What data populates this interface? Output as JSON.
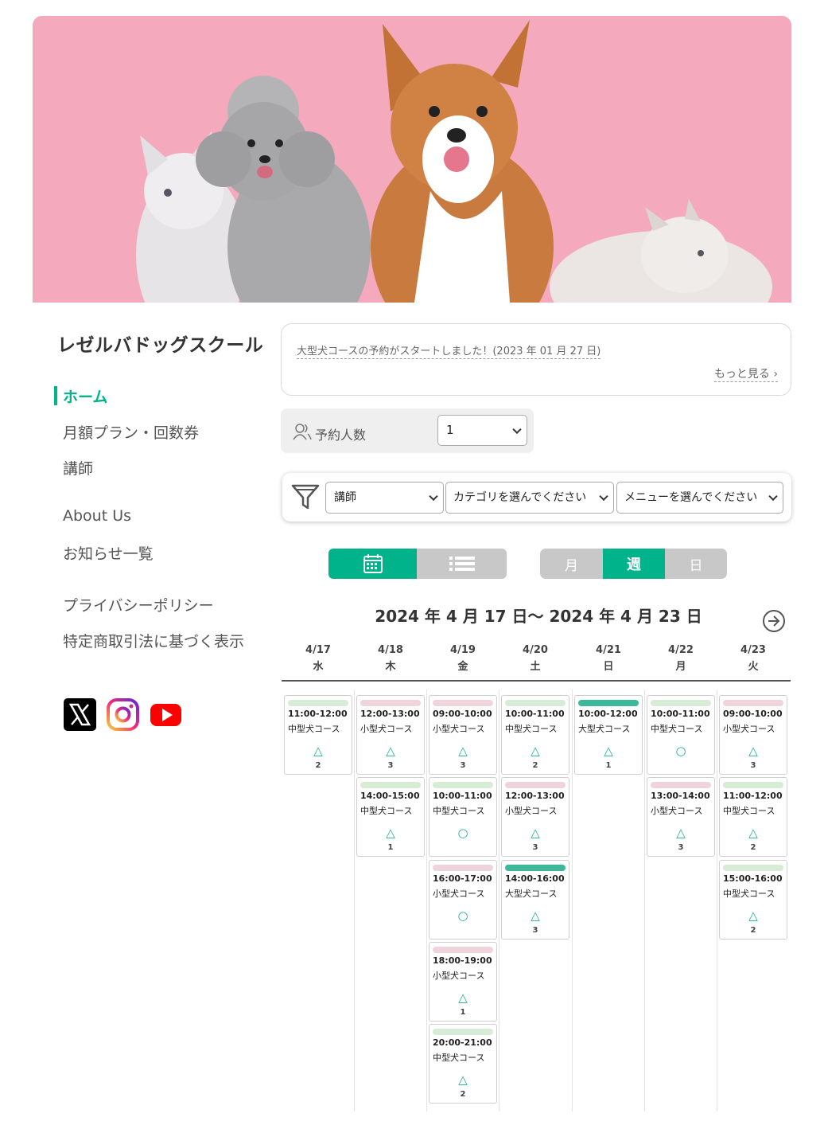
{
  "site": {
    "title": "レゼルバドッグスクール"
  },
  "nav": {
    "home": "ホーム",
    "plans": "月額プラン・回数券",
    "instructors": "講師",
    "about": "About Us",
    "news": "お知らせ一覧",
    "privacy": "プライバシーポリシー",
    "tokusho": "特定商取引法に基づく表示"
  },
  "notice": {
    "text": "大型犬コースの予約がスタートしました！(2023 年 01 月 27 日)",
    "more": "もっと見る"
  },
  "guests": {
    "label": "予約人数",
    "value": "1"
  },
  "filters": {
    "instructor": "講師",
    "category": "カテゴリを選んでください",
    "menu": "メニューを選んでください"
  },
  "view_toggle": {
    "month": "月",
    "week": "週",
    "day": "日",
    "active": "週"
  },
  "calendar": {
    "range": "2024 年 4 月 17 日〜 2024 年 4 月 23 日",
    "days": [
      {
        "date": "4/17",
        "dow": "水"
      },
      {
        "date": "4/18",
        "dow": "木"
      },
      {
        "date": "4/19",
        "dow": "金"
      },
      {
        "date": "4/20",
        "dow": "土"
      },
      {
        "date": "4/21",
        "dow": "日"
      },
      {
        "date": "4/22",
        "dow": "月"
      },
      {
        "date": "4/23",
        "dow": "火"
      }
    ],
    "course_colors": {
      "小型犬コース": "#f0d4dc",
      "中型犬コース": "#d6ecd4",
      "大型犬コース": "#3db89a"
    },
    "slots": [
      [
        {
          "time": "11:00-12:00",
          "course": "中型犬コース",
          "mark": "△",
          "count": "2"
        }
      ],
      [
        {
          "time": "12:00-13:00",
          "course": "小型犬コース",
          "mark": "△",
          "count": "3"
        },
        {
          "time": "14:00-15:00",
          "course": "中型犬コース",
          "mark": "△",
          "count": "1"
        }
      ],
      [
        {
          "time": "09:00-10:00",
          "course": "小型犬コース",
          "mark": "△",
          "count": "3"
        },
        {
          "time": "10:00-11:00",
          "course": "中型犬コース",
          "mark": "○",
          "count": ""
        },
        {
          "time": "16:00-17:00",
          "course": "小型犬コース",
          "mark": "○",
          "count": ""
        },
        {
          "time": "18:00-19:00",
          "course": "小型犬コース",
          "mark": "△",
          "count": "1"
        },
        {
          "time": "20:00-21:00",
          "course": "中型犬コース",
          "mark": "△",
          "count": "2"
        }
      ],
      [
        {
          "time": "10:00-11:00",
          "course": "中型犬コース",
          "mark": "△",
          "count": "2"
        },
        {
          "time": "12:00-13:00",
          "course": "小型犬コース",
          "mark": "△",
          "count": "3"
        },
        {
          "time": "14:00-16:00",
          "course": "大型犬コース",
          "mark": "△",
          "count": "3"
        }
      ],
      [
        {
          "time": "10:00-12:00",
          "course": "大型犬コース",
          "mark": "△",
          "count": "1"
        }
      ],
      [
        {
          "time": "10:00-11:00",
          "course": "中型犬コース",
          "mark": "○",
          "count": ""
        },
        {
          "time": "13:00-14:00",
          "course": "小型犬コース",
          "mark": "△",
          "count": "3"
        }
      ],
      [
        {
          "time": "09:00-10:00",
          "course": "小型犬コース",
          "mark": "△",
          "count": "3"
        },
        {
          "time": "11:00-12:00",
          "course": "中型犬コース",
          "mark": "△",
          "count": "2"
        },
        {
          "time": "15:00-16:00",
          "course": "中型犬コース",
          "mark": "△",
          "count": "2"
        }
      ]
    ]
  },
  "colors": {
    "accent": "#00b38b",
    "hero_bg": "#f4a9bd"
  }
}
